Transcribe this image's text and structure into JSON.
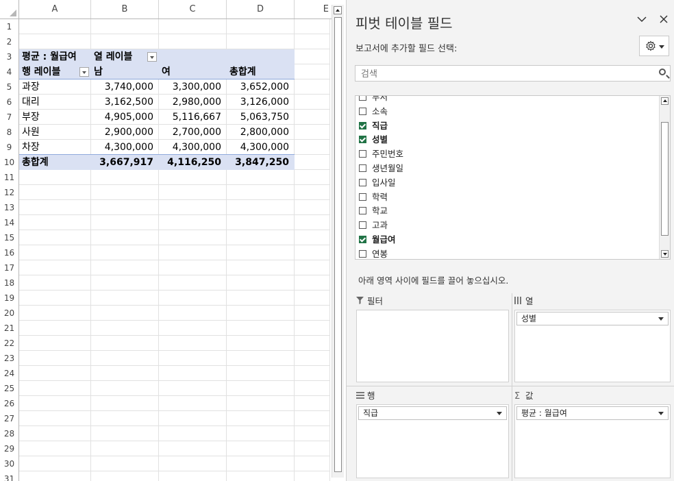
{
  "sheet": {
    "columns": [
      "A",
      "B",
      "C",
      "D",
      "E"
    ],
    "rows": [
      "1",
      "2",
      "3",
      "4",
      "5",
      "6",
      "7",
      "8",
      "9",
      "10",
      "11",
      "12",
      "13",
      "14",
      "15",
      "16",
      "17",
      "18",
      "19",
      "20",
      "21",
      "22",
      "23",
      "24",
      "25",
      "26",
      "27",
      "28",
      "29",
      "30",
      "31"
    ],
    "pivot": {
      "values_label": "평균 : 월급여",
      "col_labels_title": "열 레이블",
      "row_labels_title": "행 레이블",
      "col_headers": [
        "남",
        "여",
        "총합계"
      ],
      "rows": [
        {
          "label": "과장",
          "values": [
            "3,740,000",
            "3,300,000",
            "3,652,000"
          ]
        },
        {
          "label": "대리",
          "values": [
            "3,162,500",
            "2,980,000",
            "3,126,000"
          ]
        },
        {
          "label": "부장",
          "values": [
            "4,905,000",
            "5,116,667",
            "5,063,750"
          ]
        },
        {
          "label": "사원",
          "values": [
            "2,900,000",
            "2,700,000",
            "2,800,000"
          ]
        },
        {
          "label": "차장",
          "values": [
            "4,300,000",
            "4,300,000",
            "4,300,000"
          ]
        }
      ],
      "total": {
        "label": "총합계",
        "values": [
          "3,667,917",
          "4,116,250",
          "3,847,250"
        ]
      }
    }
  },
  "pane": {
    "title": "피벗 테이블 필드",
    "collapse_icon": "chevron-down-icon",
    "close_icon": "close-icon",
    "choose_fields_label": "보고서에 추가할 필드 선택:",
    "gear_icon": "gear-icon",
    "search_placeholder": "검색",
    "fields": [
      {
        "label": "부서",
        "checked": false
      },
      {
        "label": "소속",
        "checked": false
      },
      {
        "label": "직급",
        "checked": true
      },
      {
        "label": "성별",
        "checked": true
      },
      {
        "label": "주민번호",
        "checked": false
      },
      {
        "label": "생년월일",
        "checked": false
      },
      {
        "label": "입사일",
        "checked": false
      },
      {
        "label": "학력",
        "checked": false
      },
      {
        "label": "학교",
        "checked": false
      },
      {
        "label": "고과",
        "checked": false
      },
      {
        "label": "월급여",
        "checked": true
      },
      {
        "label": "연봉",
        "checked": false
      }
    ],
    "drag_hint": "아래 영역 사이에 필드를 끌어 놓으십시오.",
    "areas": {
      "filter": {
        "label": "필터",
        "icon": "filter-icon",
        "items": []
      },
      "columns": {
        "label": "열",
        "icon": "columns-icon",
        "items": [
          "성별"
        ]
      },
      "rows": {
        "label": "행",
        "icon": "rows-icon",
        "items": [
          "직급"
        ]
      },
      "values": {
        "label": "값",
        "icon": "sigma-icon",
        "items": [
          "평균 : 월급여"
        ]
      }
    }
  },
  "colors": {
    "pivot_band": "#dae1f3",
    "checkbox_checked": "#217346"
  }
}
